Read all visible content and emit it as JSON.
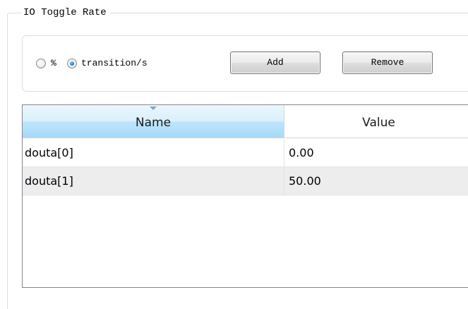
{
  "group": {
    "title": "IO Toggle Rate"
  },
  "options": {
    "radios": [
      {
        "label": "%",
        "checked": false
      },
      {
        "label": "transition/s",
        "checked": true
      }
    ],
    "add_label": "Add",
    "remove_label": "Remove"
  },
  "table": {
    "columns": [
      "Name",
      "Value"
    ],
    "rows": [
      {
        "name": "douta[0]",
        "value": "0.00"
      },
      {
        "name": "douta[1]",
        "value": "50.00"
      }
    ]
  },
  "colors": {
    "header_selected": "#bee6fd",
    "row_alt": "#ededed",
    "radio_selected": "#1c7fc7"
  }
}
